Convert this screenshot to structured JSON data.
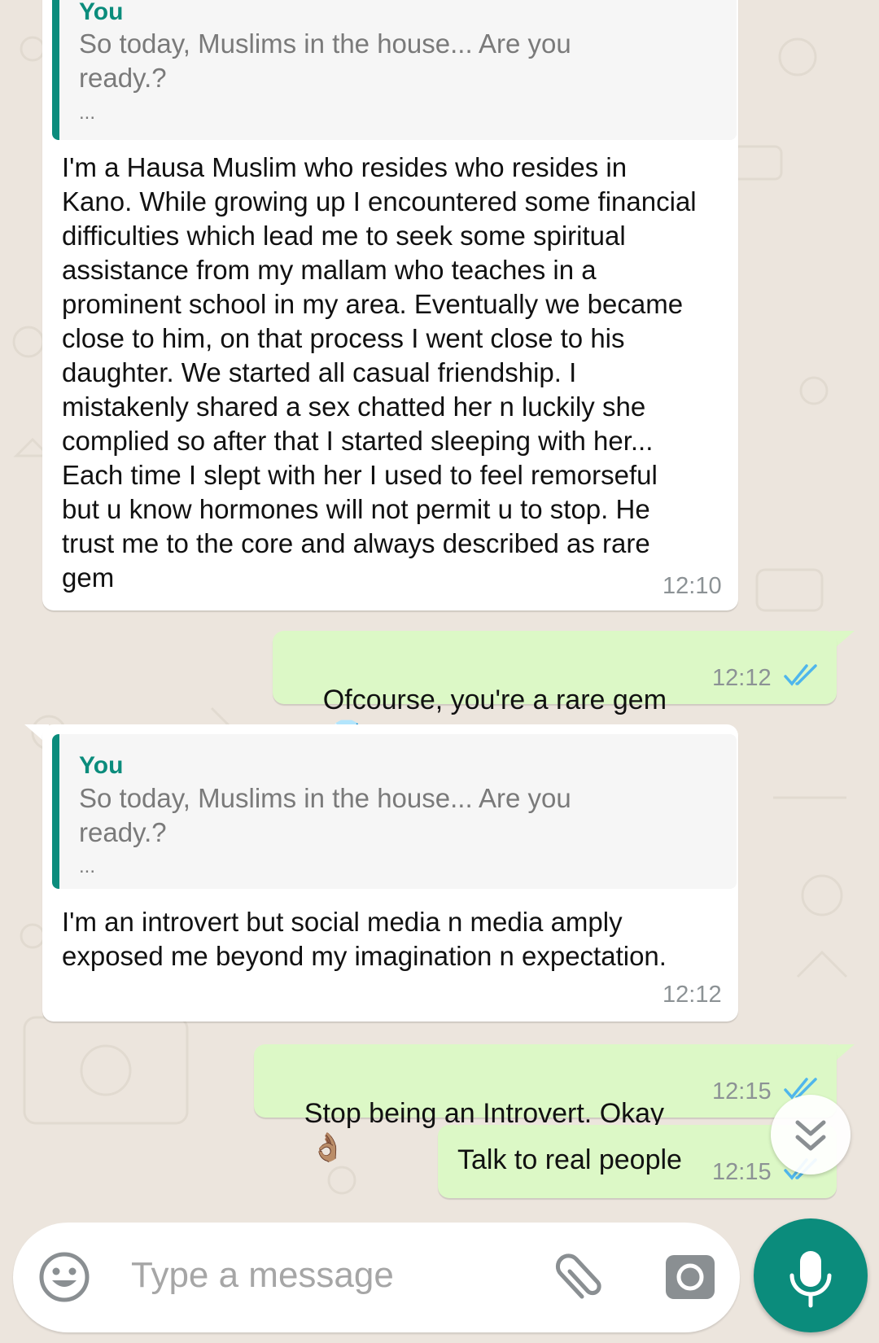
{
  "messages": [
    {
      "quote": {
        "author": "You",
        "text": "So today, Muslims in the house... Are you ready.?",
        "ellipsis": "..."
      },
      "text": "I'm a Hausa Muslim who resides who resides in Kano. While growing up I encountered some financial difficulties which lead me to seek some spiritual assistance from my mallam who teaches in a prominent school in my area. Eventually we became close to him, on that process I went close to his daughter. We started all casual friendship. I mistakenly shared a sex chatted her n luckily she complied so after that I started sleeping with her... Each time I slept with her I used to feel remorseful but u know hormones will not permit u to stop. He trust me to the core and always described as rare gem",
      "time": "12:10"
    },
    {
      "text": "Ofcourse, you're a rare gem",
      "emoji": "💎",
      "time": "12:12"
    },
    {
      "quote": {
        "author": "You",
        "text": "So today, Muslims in the house... Are you ready.?",
        "ellipsis": "..."
      },
      "text": "I'm an introvert but social media n media amply exposed me beyond my imagination n expectation.",
      "time": "12:12"
    },
    {
      "text": "Stop being an Introvert. Okay",
      "emoji": "👌🏽",
      "time": "12:15"
    },
    {
      "text": "Talk to real people",
      "time": "12:15"
    }
  ],
  "composer": {
    "placeholder": "Type a message"
  },
  "icons": {
    "emoji": "emoji-icon",
    "attach": "paperclip-icon",
    "camera": "camera-icon",
    "mic": "microphone-icon",
    "scroll": "chevron-double-down-icon",
    "read": "double-check-icon"
  },
  "colors": {
    "accent": "#0b8c7c",
    "outgoing": "#dcf8c6",
    "incoming": "#ffffff",
    "background": "#ece5dd",
    "read_tick": "#4fb6ec"
  }
}
